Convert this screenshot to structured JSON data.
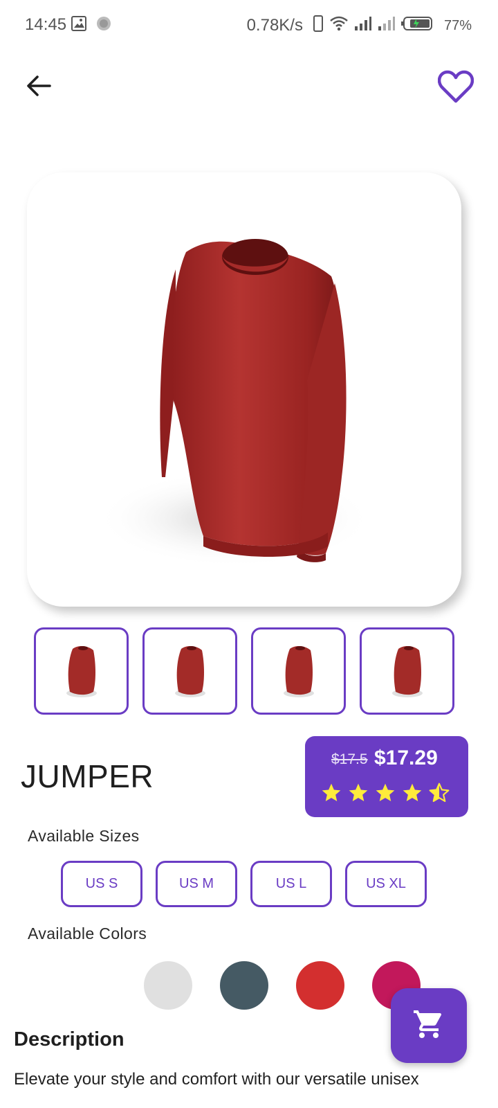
{
  "status_bar": {
    "time": "14:45",
    "network_speed": "0.78K/s",
    "battery": "77%",
    "icons": [
      "gallery-icon",
      "sync-icon",
      "vibrate-icon",
      "wifi-icon",
      "signal-icon",
      "signal-icon",
      "battery-icon"
    ]
  },
  "app_bar": {
    "back_icon": "arrow-back-icon",
    "favorite_icon": "heart-outline-icon"
  },
  "product": {
    "image": "red-jumper",
    "thumbnails": [
      "red-jumper",
      "red-jumper",
      "red-jumper",
      "red-jumper"
    ],
    "title": "JUMPER",
    "old_price": "$17.5",
    "price": "$17.29",
    "rating": 4.5,
    "rating_max": 5
  },
  "sizes": {
    "label": "Available Sizes",
    "options": [
      "US S",
      "US M",
      "US L",
      "US XL"
    ]
  },
  "colors": {
    "label": "Available Colors",
    "options": [
      "#e0e0e0",
      "#455a64",
      "#d32f2f",
      "#c2185b"
    ]
  },
  "description": {
    "heading": "Description",
    "text": "Elevate your style and comfort with our versatile unisex"
  },
  "cart_fab": {
    "icon": "cart-icon"
  },
  "theme": {
    "accent": "#6a3cc4",
    "star": "#ffeb3b"
  }
}
